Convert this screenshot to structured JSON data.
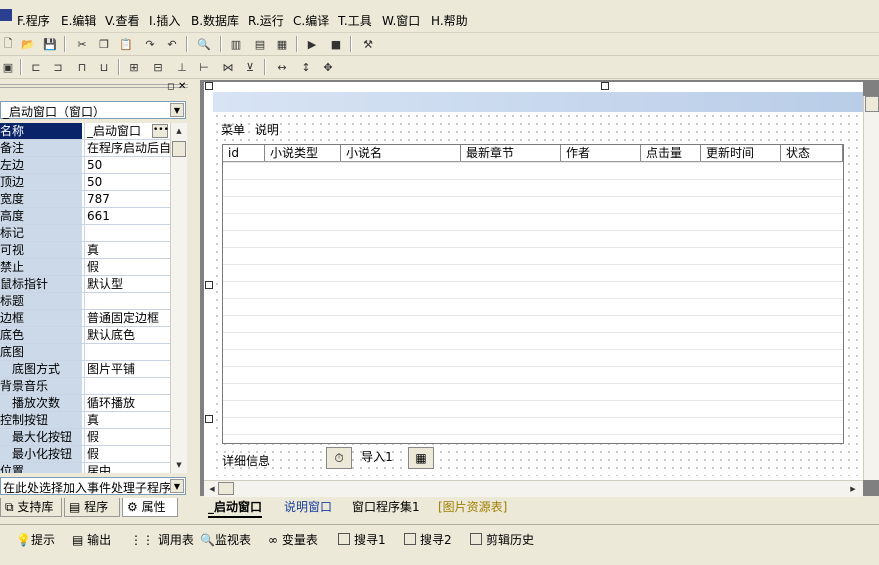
{
  "menu": [
    "F.程序",
    "E.编辑",
    "V.查看",
    "I.插入",
    "B.数据库",
    "R.运行",
    "C.编译",
    "T.工具",
    "W.窗口",
    "H.帮助"
  ],
  "left_panel": {
    "window_combo": "_启动窗口（窗口）",
    "properties": [
      {
        "name": "名称",
        "value": "_启动窗口",
        "selected": true
      },
      {
        "name": "备注",
        "value": "在程序启动后自"
      },
      {
        "name": "左边",
        "value": "50"
      },
      {
        "name": "顶边",
        "value": "50"
      },
      {
        "name": "宽度",
        "value": "787"
      },
      {
        "name": "高度",
        "value": "661"
      },
      {
        "name": "标记",
        "value": ""
      },
      {
        "name": "可视",
        "value": "真"
      },
      {
        "name": "禁止",
        "value": "假"
      },
      {
        "name": "鼠标指针",
        "value": "默认型"
      },
      {
        "name": "标题",
        "value": ""
      },
      {
        "name": "边框",
        "value": "普通固定边框"
      },
      {
        "name": "底色",
        "value": "默认底色"
      },
      {
        "name": "底图",
        "value": ""
      },
      {
        "name": "底图方式",
        "value": "图片平铺",
        "sub": true
      },
      {
        "name": "背景音乐",
        "value": ""
      },
      {
        "name": "播放次数",
        "value": "循环播放",
        "sub": true
      },
      {
        "name": "控制按钮",
        "value": "真"
      },
      {
        "name": "最大化按钮",
        "value": "假",
        "sub": true
      },
      {
        "name": "最小化按钮",
        "value": "假",
        "sub": true
      },
      {
        "name": "位置",
        "value": "居中"
      }
    ],
    "event_combo": "在此处选择加入事件处理子程序",
    "tabs": [
      "支持库",
      "程序",
      "属性"
    ]
  },
  "form": {
    "menu_items": [
      "菜单",
      "说明"
    ],
    "columns": [
      "id",
      "小说类型",
      "小说名",
      "最新章节",
      "作者",
      "点击量",
      "更新时间",
      "状态"
    ],
    "detail_label": "详细信息",
    "import_button": "导入1"
  },
  "design_tabs": [
    "_启动窗口",
    "说明窗口",
    "窗口程序集1",
    "[图片资源表]"
  ],
  "bottom_tabs": [
    "提示",
    "输出",
    "调用表",
    "监视表",
    "变量表",
    "搜寻1",
    "搜寻2",
    "剪辑历史"
  ]
}
